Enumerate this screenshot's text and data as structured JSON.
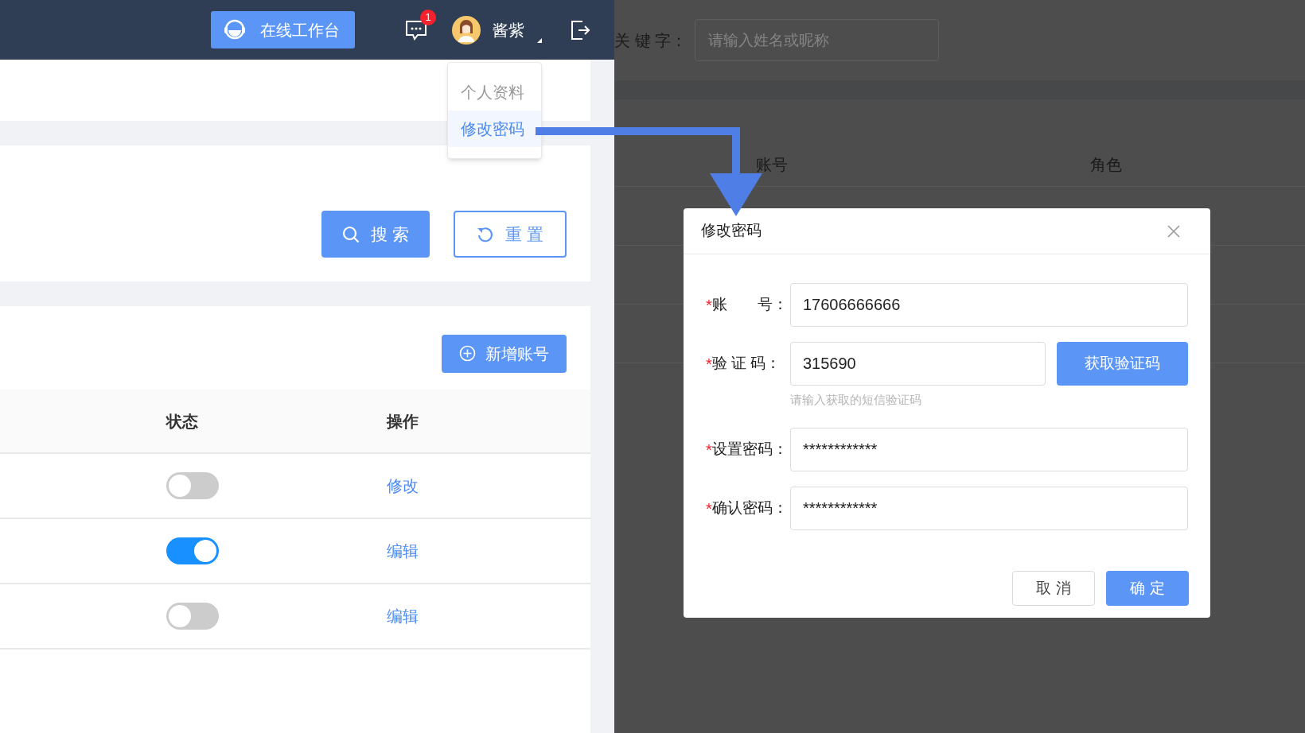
{
  "top_bar": {
    "workbench_button": "在线工作台",
    "message_badge": "1",
    "user_name": "酱紫"
  },
  "user_menu": {
    "items": [
      {
        "label": "个人资料",
        "selected": false
      },
      {
        "label": "修改密码",
        "selected": true
      }
    ]
  },
  "search_actions": {
    "search_button": "搜 索",
    "reset_button": "重 置"
  },
  "add_button": "新增账号",
  "table": {
    "columns": [
      "状态",
      "操作"
    ],
    "rows": [
      {
        "enabled": false,
        "action": "修改"
      },
      {
        "enabled": true,
        "action": "编辑"
      },
      {
        "enabled": false,
        "action": "编辑"
      }
    ]
  },
  "background": {
    "keyword_label": "关 键 字：",
    "keyword_placeholder": "请输入姓名或昵称",
    "columns": [
      "账号",
      "角色"
    ]
  },
  "dialog": {
    "title": "修改密码",
    "fields": [
      {
        "required_mark": "*",
        "label": "账　　号：",
        "value": "17606666666"
      },
      {
        "required_mark": "*",
        "label": "验 证 码：",
        "value": "315690",
        "button": "获取验证码",
        "hint": "请输入获取的短信验证码"
      },
      {
        "required_mark": "*",
        "label": "设置密码：",
        "value": "************"
      },
      {
        "required_mark": "*",
        "label": "确认密码：",
        "value": "************"
      }
    ],
    "buttons": [
      {
        "label": "取 消",
        "kind": "default"
      },
      {
        "label": "确 定",
        "kind": "primary"
      }
    ]
  }
}
